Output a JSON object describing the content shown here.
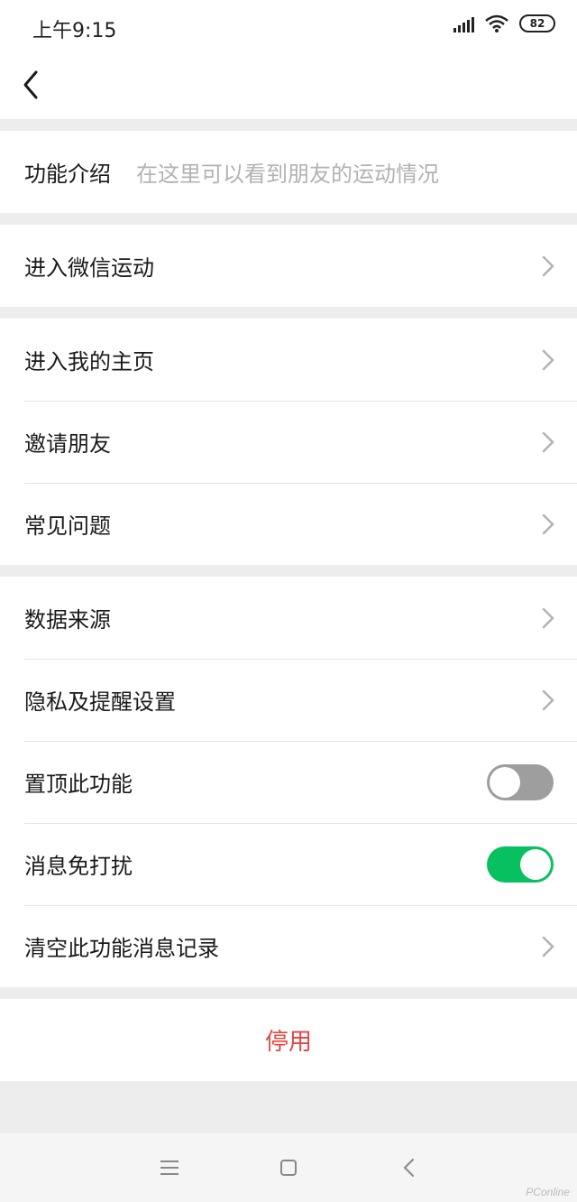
{
  "status": {
    "time": "上午9:15",
    "battery": "82"
  },
  "intro": {
    "label": "功能介绍",
    "desc": "在这里可以看到朋友的运动情况"
  },
  "groups": [
    {
      "items": [
        {
          "label": "进入微信运动",
          "type": "link"
        }
      ]
    },
    {
      "items": [
        {
          "label": "进入我的主页",
          "type": "link"
        },
        {
          "label": "邀请朋友",
          "type": "link"
        },
        {
          "label": "常见问题",
          "type": "link"
        }
      ]
    },
    {
      "items": [
        {
          "label": "数据来源",
          "type": "link"
        },
        {
          "label": "隐私及提醒设置",
          "type": "link"
        },
        {
          "label": "置顶此功能",
          "type": "toggle",
          "on": false
        },
        {
          "label": "消息免打扰",
          "type": "toggle",
          "on": true
        },
        {
          "label": "清空此功能消息记录",
          "type": "link"
        }
      ]
    }
  ],
  "stop_button": "停用",
  "colors": {
    "accent_green": "#07c160",
    "danger_red": "#e64340",
    "toggle_off": "#9e9e9e"
  },
  "watermark": "PConline"
}
